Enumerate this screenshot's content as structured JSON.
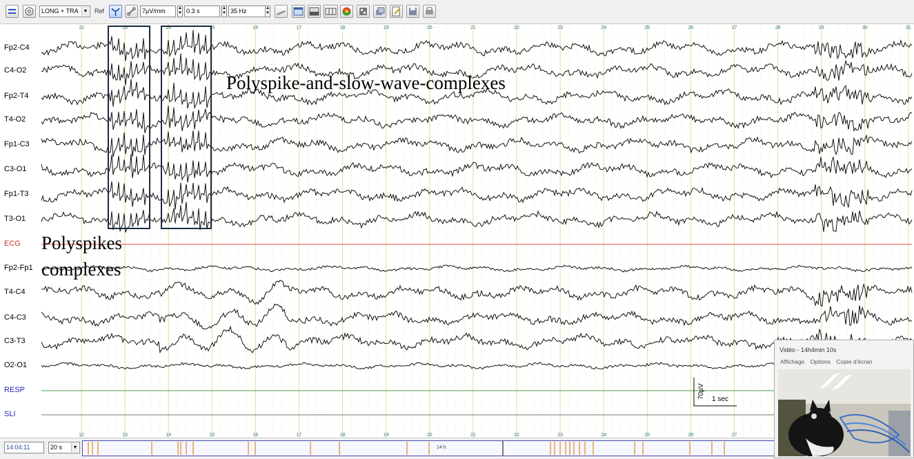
{
  "toolbar": {
    "montage": "LONG + TRA",
    "ref_label": "Ref",
    "sensitivity": "7µV/mm",
    "time_constant": "0.3 s",
    "filter": "35 Hz"
  },
  "top_ruler": [
    "12",
    "13",
    "14",
    "15",
    "16",
    "17",
    "18",
    "19",
    "20",
    "21",
    "22",
    "23",
    "24",
    "25",
    "26",
    "27",
    "28",
    "29",
    "30",
    "31"
  ],
  "bottom_ruler": [
    "12",
    "13",
    "14",
    "15",
    "16",
    "17",
    "18",
    "19",
    "20",
    "21",
    "22",
    "23",
    "24",
    "25",
    "26",
    "27"
  ],
  "channels": [
    {
      "label": "Fp2-C4",
      "color": "#000000"
    },
    {
      "label": "C4-O2",
      "color": "#000000"
    },
    {
      "label": "Fp2-T4",
      "color": "#000000"
    },
    {
      "label": "T4-O2",
      "color": "#000000"
    },
    {
      "label": "Fp1-C3",
      "color": "#000000"
    },
    {
      "label": "C3-O1",
      "color": "#000000"
    },
    {
      "label": "Fp1-T3",
      "color": "#000000"
    },
    {
      "label": "T3-O1",
      "color": "#000000"
    },
    {
      "label": "ECG",
      "color": "#d03030"
    },
    {
      "label": "Fp2-Fp1",
      "color": "#000000"
    },
    {
      "label": "T4-C4",
      "color": "#000000"
    },
    {
      "label": "C4-C3",
      "color": "#000000"
    },
    {
      "label": "C3-T3",
      "color": "#000000"
    },
    {
      "label": "O2-O1",
      "color": "#000000"
    },
    {
      "label": "RESP",
      "color": "#2626b8"
    },
    {
      "label": "SLI",
      "color": "#2626b8"
    }
  ],
  "annotations": {
    "polyspike_slow": "Polyspike-and-slow-wave-complexes",
    "polyspikes_line1": "Polyspikes",
    "polyspikes_line2": "complexes"
  },
  "scale_bar": {
    "amplitude": "70µV",
    "time": "1 sec"
  },
  "bottom": {
    "time": "14:04:11",
    "page_duration": "20 s",
    "marker": "14 h"
  },
  "video": {
    "title": "Vidéo - 14h4min 10s",
    "menu": [
      "Affichage",
      "Options",
      "Copie d'écran"
    ]
  },
  "colors": {
    "grid": "#e2dd9e",
    "ecg": "#e04848",
    "resp": "#4a9a4a",
    "sli": "#777777",
    "box": "#1b2a46"
  }
}
